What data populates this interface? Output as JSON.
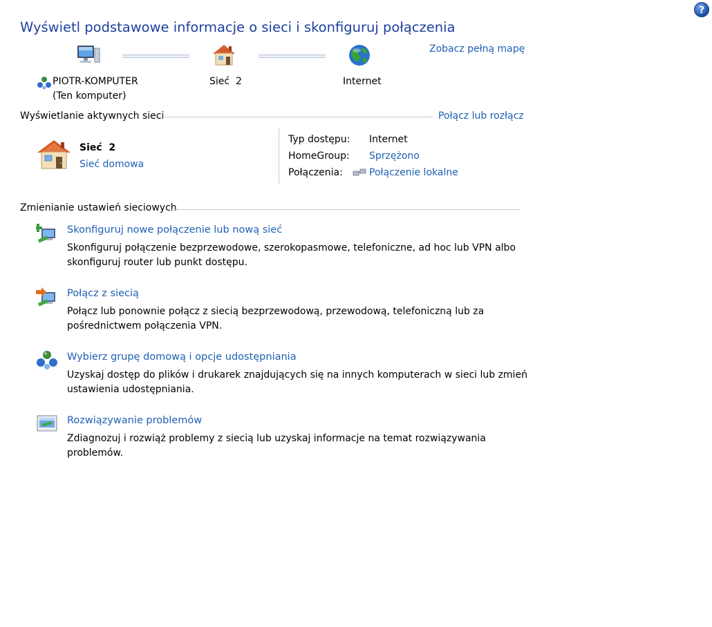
{
  "header": {
    "title": "Wyświetl podstawowe informacje o sieci i skonfiguruj połączenia",
    "full_map_link": "Zobacz pełną mapę",
    "help_glyph": "?"
  },
  "network_map": {
    "computer_name": "PIOTR-KOMPUTER",
    "computer_sub": "(Ten komputer)",
    "network_name": "Sieć  2",
    "internet_label": "Internet"
  },
  "active_networks": {
    "heading": "Wyświetlanie aktywnych sieci",
    "connect_link": "Połącz lub rozłącz",
    "network_name": "Sieć  2",
    "network_type": "Sieć domowa",
    "access_type_label": "Typ dostępu:",
    "access_type_value": "Internet",
    "homegroup_label": "HomeGroup:",
    "homegroup_value": "Sprzężono",
    "connections_label": "Połączenia:",
    "connections_value": "Połączenie lokalne"
  },
  "change_settings": {
    "heading": "Zmienianie ustawień sieciowych",
    "tasks": [
      {
        "title": "Skonfiguruj nowe połączenie lub nową sieć",
        "desc1": "Skonfiguruj połączenie bezprzewodowe, szerokopasmowe, telefoniczne, ad hoc lub VPN albo",
        "desc2": "skonfiguruj router lub punkt dostępu."
      },
      {
        "title": "Połącz z siecią",
        "desc1": "Połącz lub ponownie połącz z siecią bezprzewodową, przewodową, telefoniczną lub za",
        "desc2": "pośrednictwem połączenia VPN."
      },
      {
        "title": "Wybierz grupę domową i opcje udostępniania",
        "desc1": "Uzyskaj dostęp do plików i drukarek znajdujących się na innych komputerach w sieci lub zmień",
        "desc2": "ustawienia udostępniania."
      },
      {
        "title": "Rozwiązywanie problemów",
        "desc1": "Zdiagnozuj i rozwiąż problemy z siecią lub uzyskaj informacje na temat rozwiązywania",
        "desc2": "problemów."
      }
    ]
  }
}
